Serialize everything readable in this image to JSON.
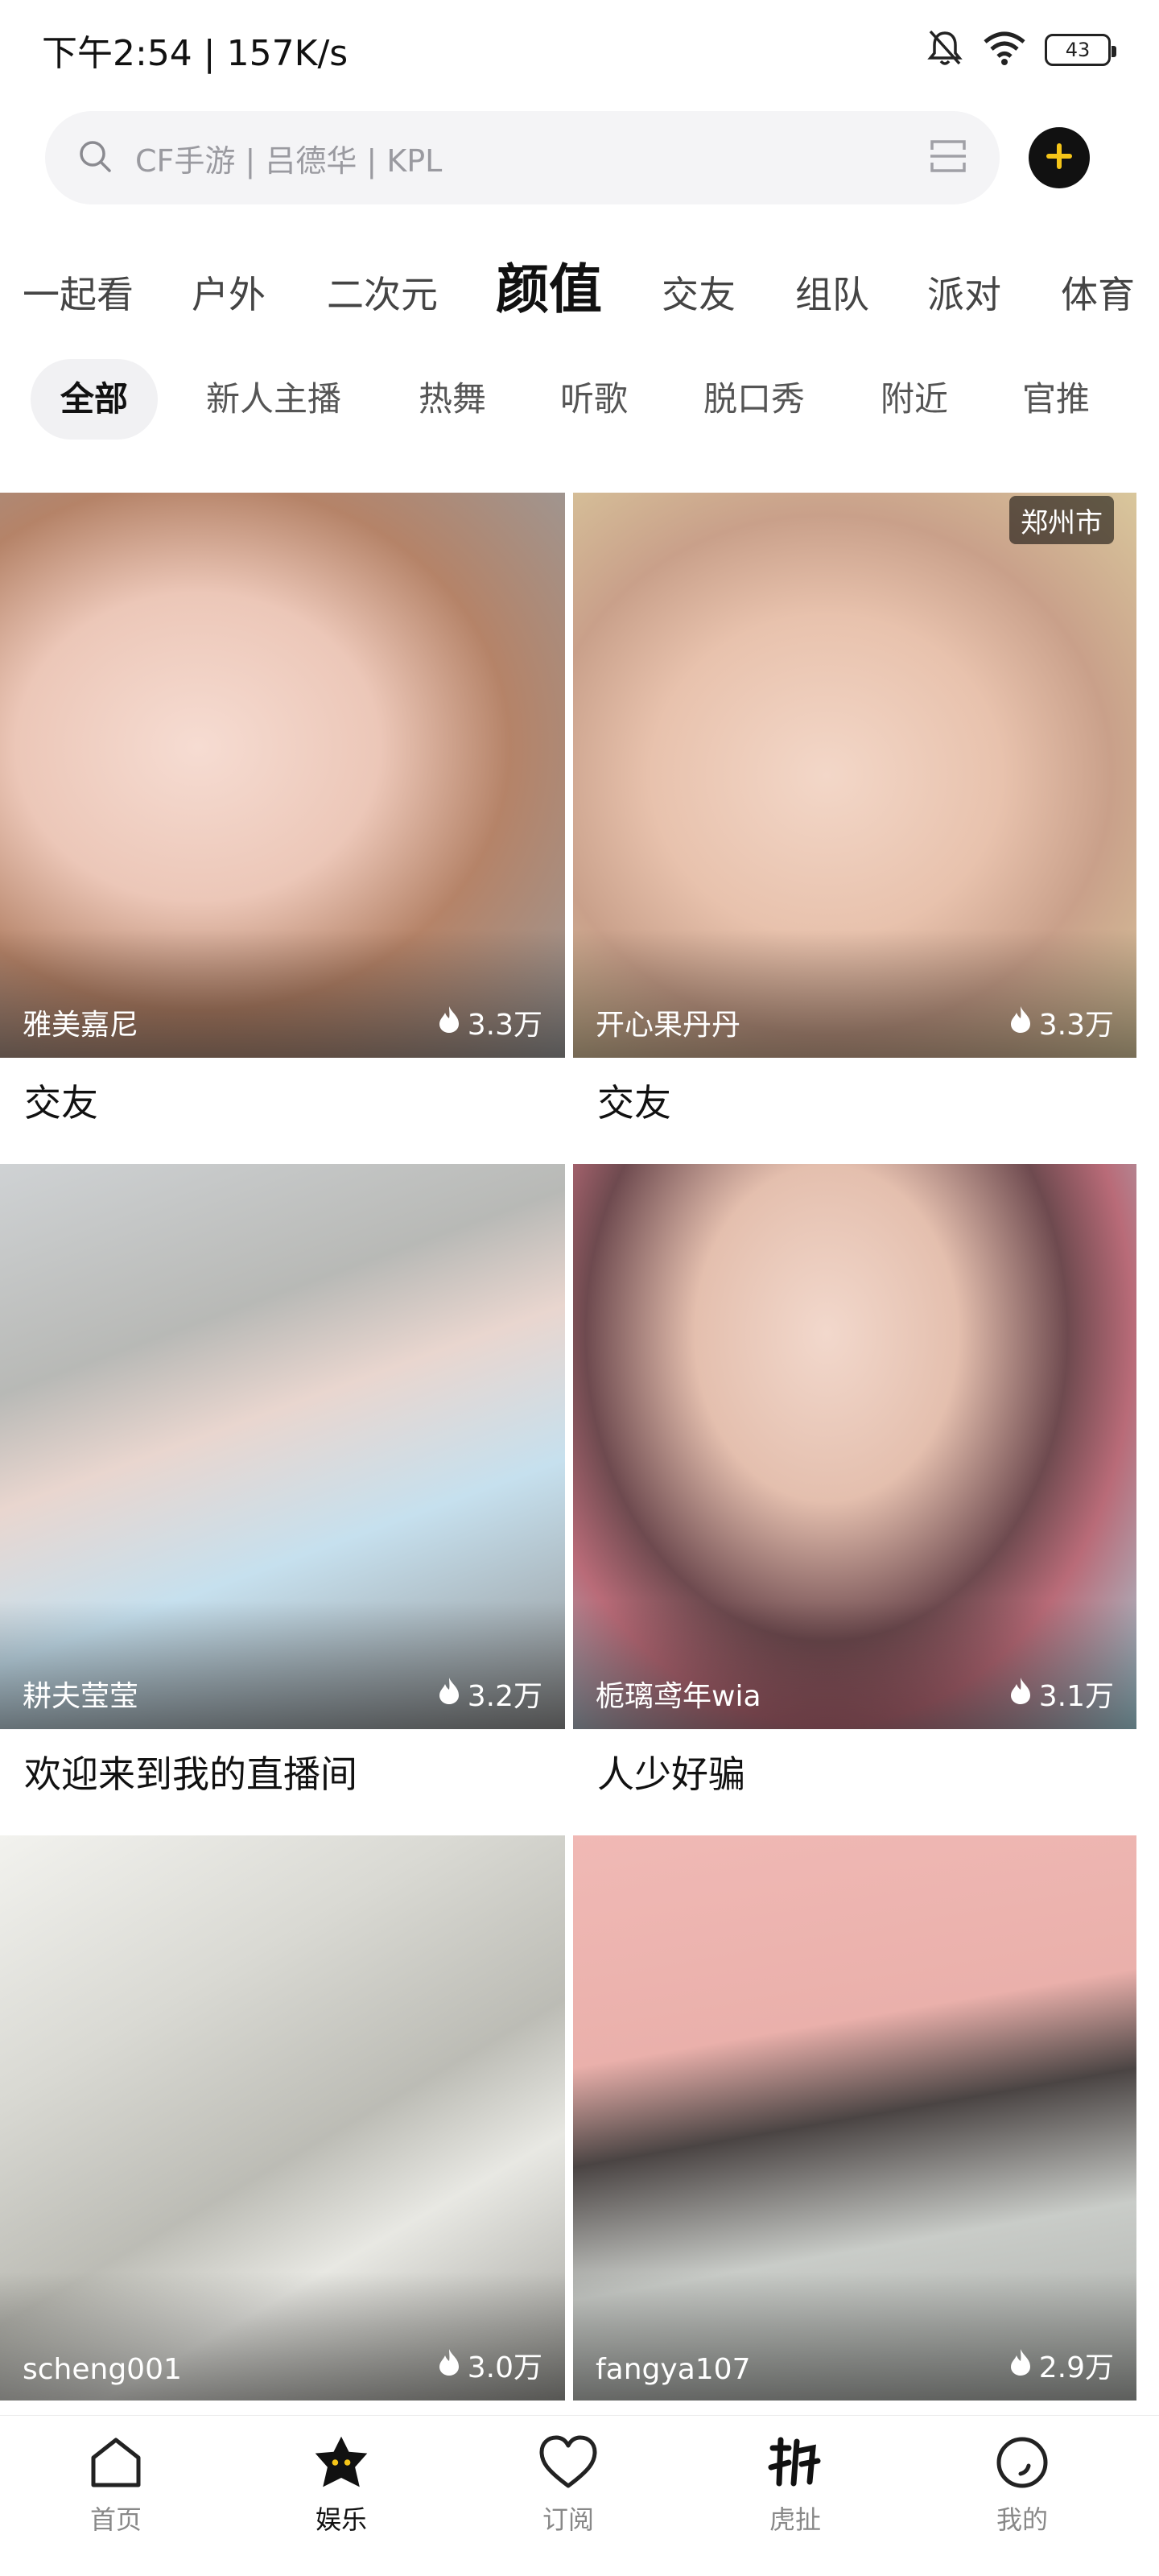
{
  "status_bar": {
    "time_speed": "下午2:54 | 157K/s",
    "battery": "43",
    "icons": [
      "mute-icon",
      "wifi-icon",
      "battery-icon"
    ]
  },
  "search": {
    "placeholder": "CF手游 | 吕德华 | KPL",
    "icons": [
      "search-icon",
      "scan-icon",
      "plus-icon"
    ]
  },
  "category_tabs": [
    "一起看",
    "户外",
    "二次元",
    "颜值",
    "交友",
    "组队",
    "派对",
    "体育"
  ],
  "active_category": "颜值",
  "filter_chips": [
    "全部",
    "新人主播",
    "热舞",
    "听歌",
    "脱口秀",
    "附近",
    "官推"
  ],
  "active_chip": "全部",
  "streams": [
    {
      "streamer": "雅美嘉尼",
      "viewers": "3.3万",
      "title": "交友",
      "location": ""
    },
    {
      "streamer": "开心果丹丹",
      "viewers": "3.3万",
      "title": "交友",
      "location": "郑州市"
    },
    {
      "streamer": "耕夫莹莹",
      "viewers": "3.2万",
      "title": "欢迎来到我的直播间",
      "location": ""
    },
    {
      "streamer": "栀璃鸢年wia",
      "viewers": "3.1万",
      "title": "人少好骗",
      "location": ""
    },
    {
      "streamer": "scheng001",
      "viewers": "3.0万",
      "title": "",
      "location": ""
    },
    {
      "streamer": "fangya107",
      "viewers": "2.9万",
      "title": "",
      "location": ""
    }
  ],
  "bottom_nav": [
    {
      "label": "首页",
      "icon": "home-icon"
    },
    {
      "label": "娱乐",
      "icon": "entertainment-icon"
    },
    {
      "label": "订阅",
      "icon": "heart-icon"
    },
    {
      "label": "虎扯",
      "icon": "huche-icon"
    },
    {
      "label": "我的",
      "icon": "profile-icon"
    }
  ],
  "active_nav": "娱乐",
  "colors": {
    "accent_yellow": "#f5c518",
    "text_primary": "#111111",
    "text_secondary": "#555555",
    "chip_bg": "#f1f1f3",
    "search_bg": "#f4f4f6"
  }
}
